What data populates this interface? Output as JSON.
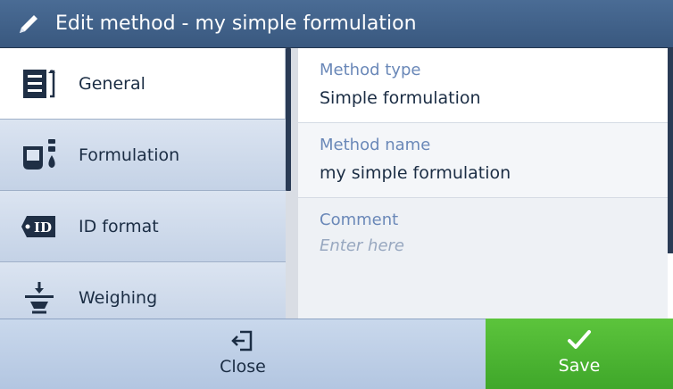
{
  "window": {
    "title": "Edit method - my simple formulation"
  },
  "sidebar": {
    "items": [
      {
        "label": "General",
        "icon": "general-settings-icon",
        "active": true
      },
      {
        "label": "Formulation",
        "icon": "formulation-icon",
        "active": false
      },
      {
        "label": "ID format",
        "icon": "id-tag-icon",
        "active": false
      },
      {
        "label": "Weighing",
        "icon": "weighing-icon",
        "active": false
      }
    ]
  },
  "fields": [
    {
      "label": "Method type",
      "value": "Simple formulation"
    },
    {
      "label": "Method name",
      "value": "my simple formulation"
    },
    {
      "label": "Comment",
      "placeholder": "Enter here"
    }
  ],
  "footer": {
    "close_label": "Close",
    "save_label": "Save"
  },
  "colors": {
    "header": "#3e5f88",
    "accent": "#6a88b8",
    "save": "#4cb532",
    "text": "#1b2d44"
  }
}
